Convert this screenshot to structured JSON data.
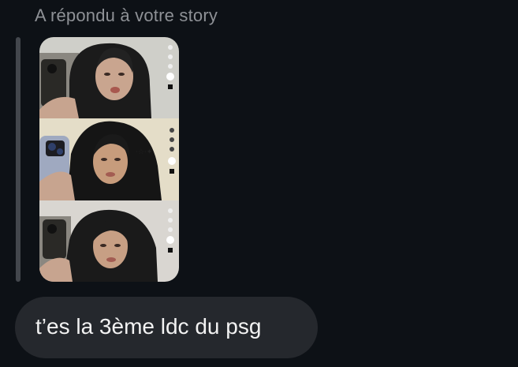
{
  "conversation": {
    "reply_caption": "A répondu à votre story",
    "story": {
      "thumbnail_icon": "story-collage-image",
      "frames": 3
    },
    "message": {
      "text": "t’es la 3ème ldc du psg"
    }
  },
  "colors": {
    "background": "#0d1116",
    "caption": "#8e9196",
    "quote_bar": "#43474d",
    "bubble": "#25282d",
    "bubble_text": "#f2f2f2"
  }
}
